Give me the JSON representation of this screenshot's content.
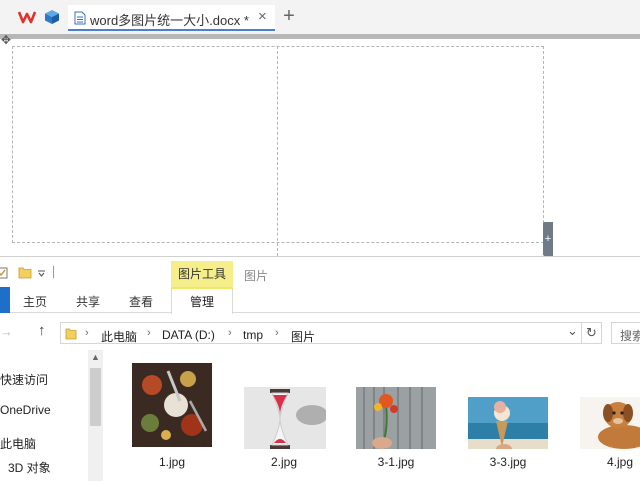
{
  "wps_tabbar": {
    "doc_tab_title": "word多图片统一大小.docx *",
    "close_glyph": "×",
    "new_tab_glyph": "+"
  },
  "document": {
    "move_handle_glyph": "✥",
    "add_handle_glyph": "+"
  },
  "explorer": {
    "ribbon": {
      "contextual_group": "图片工具",
      "contextual_title": "图片",
      "tabs": [
        "主页",
        "共享",
        "查看",
        "管理"
      ]
    },
    "address": {
      "crumbs": [
        "此电脑",
        "DATA (D:)",
        "tmp",
        "图片"
      ],
      "separator": "›",
      "dropdown_glyph": "⌄",
      "refresh_glyph": "↻",
      "search_placeholder": "搜索"
    },
    "nav_items": [
      "快速访问",
      "OneDrive",
      "此电脑",
      "3D 对象"
    ],
    "files": [
      {
        "name": "1.jpg",
        "icon": "spices-photo"
      },
      {
        "name": "2.jpg",
        "icon": "hourglass-photo"
      },
      {
        "name": "3-1.jpg",
        "icon": "flower-photo"
      },
      {
        "name": "3-3.jpg",
        "icon": "icecream-photo"
      },
      {
        "name": "4.jpg",
        "icon": "dog-photo"
      }
    ]
  },
  "colors": {
    "tab_accent": "#4a7fd4",
    "contextual_yellow": "#f6ee8b",
    "home_tab_blue": "#1e6fc9",
    "wps_red": "#e0322b"
  }
}
